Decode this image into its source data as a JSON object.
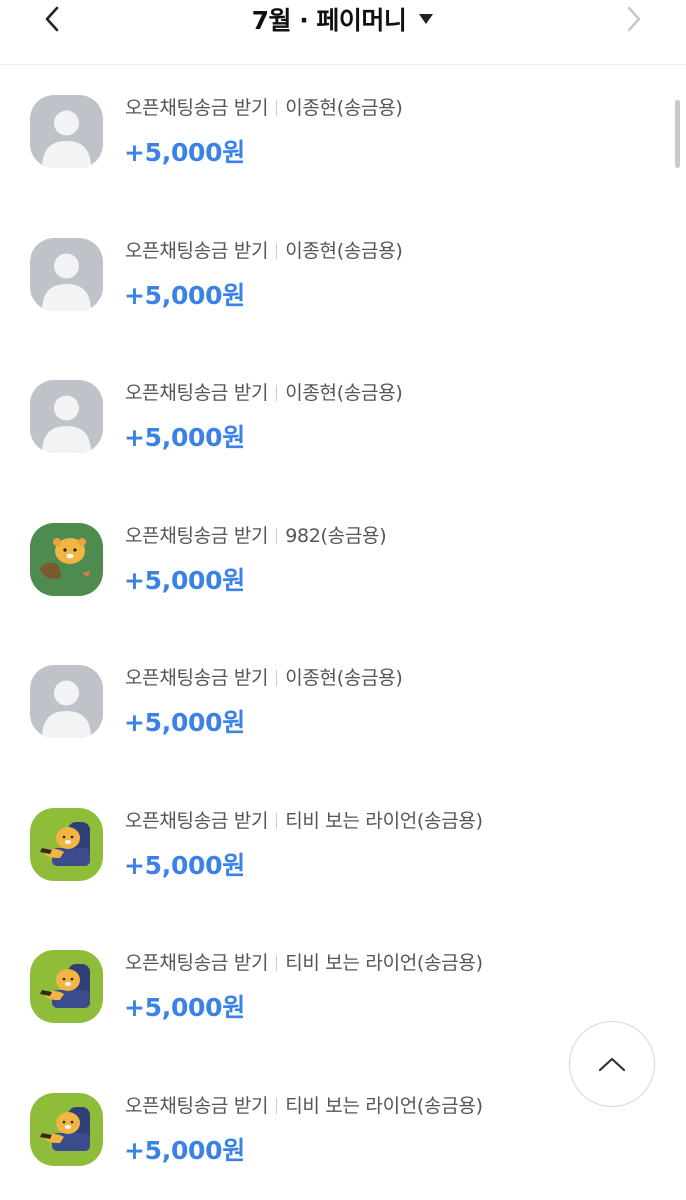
{
  "header": {
    "title": "7월 · 페이머니",
    "back_icon": "chevron-left-icon",
    "next_icon": "chevron-right-icon",
    "dropdown_icon": "caret-down-icon"
  },
  "transactions": [
    {
      "type": "오픈채팅송금 받기",
      "sender": "이종현(송금용)",
      "amount": "+5,000원",
      "avatar": "default-profile"
    },
    {
      "type": "오픈채팅송금 받기",
      "sender": "이종현(송금용)",
      "amount": "+5,000원",
      "avatar": "default-profile"
    },
    {
      "type": "오픈채팅송금 받기",
      "sender": "이종현(송금용)",
      "amount": "+5,000원",
      "avatar": "default-profile"
    },
    {
      "type": "오픈채팅송금 받기",
      "sender": "982(송금용)",
      "amount": "+5,000원",
      "avatar": "lion-character-dark-green"
    },
    {
      "type": "오픈채팅송금 받기",
      "sender": "이종현(송금용)",
      "amount": "+5,000원",
      "avatar": "default-profile"
    },
    {
      "type": "오픈채팅송금 받기",
      "sender": "티비 보는 라이언(송금용)",
      "amount": "+5,000원",
      "avatar": "lion-on-sofa"
    },
    {
      "type": "오픈채팅송금 받기",
      "sender": "티비 보는 라이언(송금용)",
      "amount": "+5,000원",
      "avatar": "lion-on-sofa"
    },
    {
      "type": "오픈채팅송금 받기",
      "sender": "티비 보는 라이언(송금용)",
      "amount": "+5,000원",
      "avatar": "lion-on-sofa"
    }
  ],
  "scroll_top_icon": "chevron-up-icon",
  "colors": {
    "amount": "#3b82e6",
    "default_avatar_bg": "#bfc3c9",
    "lion_avatar_green": "#8fbd3a",
    "lion_avatar_dark_green": "#4d8b4f"
  }
}
